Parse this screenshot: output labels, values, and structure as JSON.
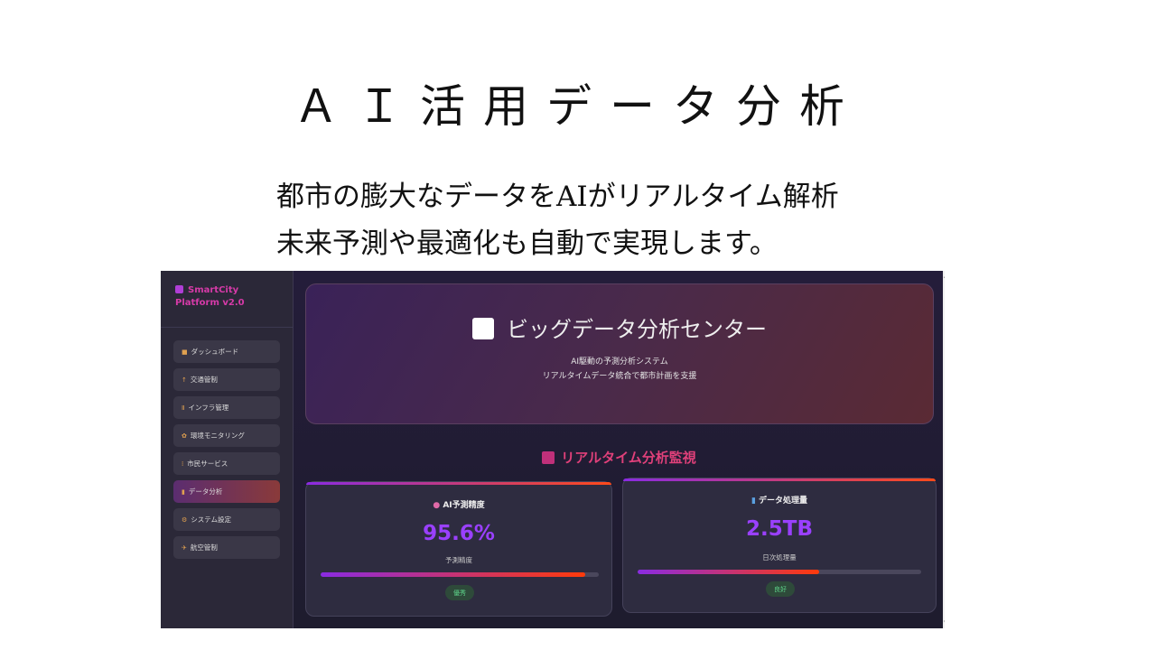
{
  "slide": {
    "title": "ＡＩ活用データ分析",
    "subtitle_line1": "都市の膨大なデータをAIがリアルタイム解析",
    "subtitle_line2": "未来予測や最適化も自動で実現します。"
  },
  "sidebar": {
    "brand": "SmartCity Platform v2.0",
    "items": [
      {
        "icon": "home-icon",
        "glyph": "■",
        "label": "ダッシュボード"
      },
      {
        "icon": "traffic-icon",
        "glyph": "↑",
        "label": "交通管制"
      },
      {
        "icon": "infra-icon",
        "glyph": "Ⅱ",
        "label": "インフラ管理"
      },
      {
        "icon": "leaf-icon",
        "glyph": "✿",
        "label": "環境モニタリング"
      },
      {
        "icon": "people-icon",
        "glyph": "⁞",
        "label": "市民サービス"
      },
      {
        "icon": "chart-icon",
        "glyph": "▮",
        "label": "データ分析"
      },
      {
        "icon": "gear-icon",
        "glyph": "⚙",
        "label": "システム設定"
      },
      {
        "icon": "airplane-icon",
        "glyph": "✈",
        "label": "航空管制"
      }
    ],
    "active_index": 5
  },
  "hero": {
    "title": "ビッグデータ分析センター",
    "line1": "AI駆動の予測分析システム",
    "line2": "リアルタイムデータ統合で都市計画を支援"
  },
  "section": {
    "title": "リアルタイム分析監視"
  },
  "cards": [
    {
      "icon": "brain-icon",
      "label": "AI予測精度",
      "value": "95.6%",
      "caption": "予測精度",
      "progress": 0.95,
      "badge": "優秀"
    },
    {
      "icon": "chart-icon",
      "label": "データ処理量",
      "value": "2.5TB",
      "caption": "日次処理量",
      "progress": 0.64,
      "badge": "良好"
    }
  ],
  "colors": {
    "accent": "#9a40ff",
    "brand": "#d63aa8",
    "section": "#e0407a",
    "badge_text": "#5ed48a"
  }
}
